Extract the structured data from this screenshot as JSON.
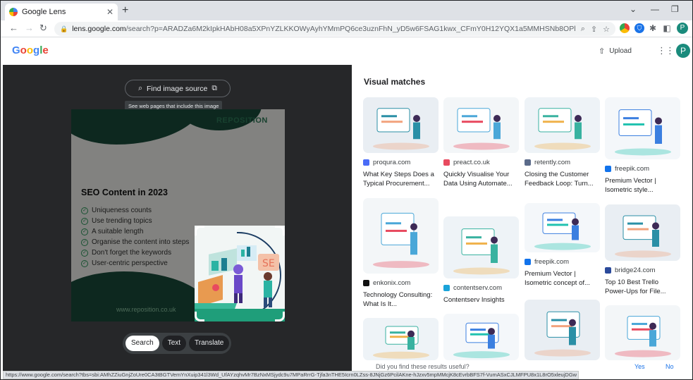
{
  "browser": {
    "tab_title": "Google Lens",
    "tab_close": "✕",
    "new_tab": "+",
    "url_host": "lens.google.com",
    "url_path": "/search?p=ARADZa6M2kIpkHAbH08a5XPnYZLKKOWyAyhYMmPQ6ce3uznFhN_yD5w6FSAG1kwx_CFmY0H12YQX1a5MMHSNb8OPlzQfruYSgIuI13sMshN_5wfimK7...",
    "status_url": "https://www.google.com/search?tbs=sbi:AMhZZiuGnjZoUre0CA3tBGTVemYnXuip341l3Wd_UfAYzqhvMr7BzNxMSjydc9u7MPaRrrG-Tjfa3nTHE5Icrn0LZss-8JNjGz6PcilAKne-hJzxv5mpMMcjK8cEvrbBFS7f-VumASxCJLMFPU8x1L8rO5xleujDGw"
  },
  "header": {
    "logo_letters": [
      {
        "char": "G",
        "color": "#4285f4"
      },
      {
        "char": "o",
        "color": "#ea4335"
      },
      {
        "char": "o",
        "color": "#fbbc05"
      },
      {
        "char": "g",
        "color": "#4285f4"
      },
      {
        "char": "l",
        "color": "#34a853"
      },
      {
        "char": "e",
        "color": "#ea4335"
      }
    ],
    "upload_label": "Upload",
    "avatar_initial": "P"
  },
  "lens": {
    "find_source_label": "Find image source",
    "tooltip": "See web pages that include this image",
    "modes": [
      "Search",
      "Text",
      "Translate"
    ],
    "active_mode": "Search"
  },
  "image": {
    "brand": "REPOSITION",
    "title": "SEO Content in 2023",
    "bullets": [
      "Uniqueness counts",
      "Use trending topics",
      "A suitable length",
      "Organise the content into steps",
      "Don't forget the keywords",
      "User-centric perspective"
    ],
    "website": "www.reposition.co.uk"
  },
  "results": {
    "heading": "Visual matches",
    "columns": [
      [
        {
          "source": "proqura.com",
          "caption": "What Key Steps Does a Typical Procurement...",
          "icon_color": "#4a6cf7"
        },
        {
          "source": "enkonix.com",
          "caption": "Technology Consulting: What Is It...",
          "icon_color": "#111111"
        },
        {
          "source": "",
          "caption": "",
          "icon_color": "#ffffff"
        }
      ],
      [
        {
          "source": "preact.co.uk",
          "caption": "Quickly Visualise Your Data Using Automate...",
          "icon_color": "#e84a5f"
        },
        {
          "source": "contentserv.com",
          "caption": "Contentserv Insights",
          "icon_color": "#1aa3d9"
        },
        {
          "source": "",
          "caption": "",
          "icon_color": "#ffffff"
        }
      ],
      [
        {
          "source": "retently.com",
          "caption": "Closing the Customer Feedback Loop: Turn...",
          "icon_color": "#5b6b8a"
        },
        {
          "source": "freepik.com",
          "caption": "Premium Vector | Isometric concept of...",
          "icon_color": "#1273eb"
        },
        {
          "source": "",
          "caption": "",
          "icon_color": "#ffffff"
        }
      ],
      [
        {
          "source": "freepik.com",
          "caption": "Premium Vector | Isometric style...",
          "icon_color": "#1273eb"
        },
        {
          "source": "bridge24.com",
          "caption": "Top 10 Best Trello Power-Ups for File...",
          "icon_color": "#2b4a9b"
        },
        {
          "source": "",
          "caption": "",
          "icon_color": "#ffffff"
        }
      ]
    ],
    "feedback_question": "Did you find these results useful?",
    "yes": "Yes",
    "no": "No"
  }
}
